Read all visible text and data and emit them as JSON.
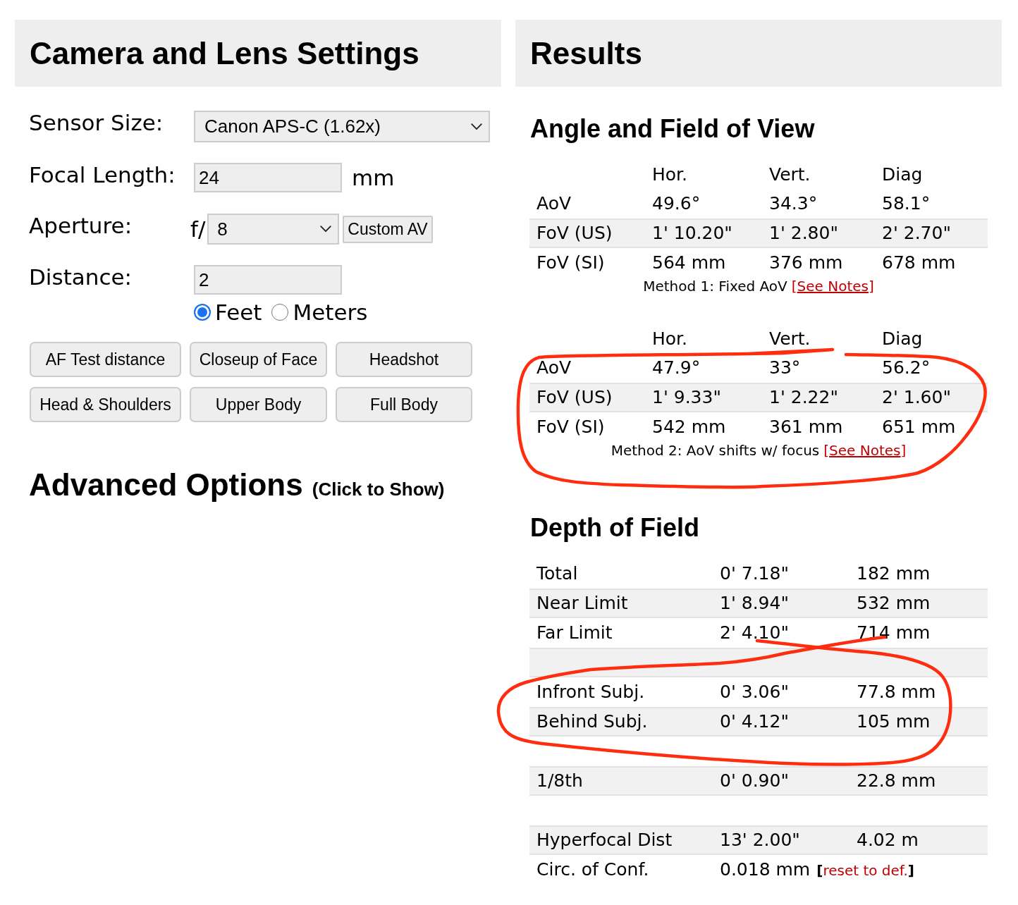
{
  "settings": {
    "title": "Camera and Lens Settings",
    "sensor_size": {
      "label": "Sensor Size:",
      "value": "Canon APS-C (1.62x)"
    },
    "focal_length": {
      "label": "Focal Length:",
      "value": "24",
      "unit": "mm"
    },
    "aperture": {
      "label": "Aperture:",
      "prefix": "f/",
      "value": "8",
      "button": "Custom AV"
    },
    "distance": {
      "label": "Distance:",
      "value": "2",
      "units": [
        {
          "label": "Feet",
          "selected": true
        },
        {
          "label": "Meters",
          "selected": false
        }
      ]
    },
    "presets": [
      "AF Test distance",
      "Closeup of Face",
      "Headshot",
      "Head & Shoulders",
      "Upper Body",
      "Full Body"
    ],
    "advanced": {
      "title": "Advanced Options",
      "hint": "(Click to Show)"
    }
  },
  "results": {
    "title": "Results",
    "angle_section": {
      "title": "Angle and Field of View",
      "tables": [
        {
          "columns": [
            "Hor.",
            "Vert.",
            "Diag"
          ],
          "rows": [
            {
              "label": "AoV",
              "values": [
                "49.6°",
                "34.3°",
                "58.1°"
              ]
            },
            {
              "label": "FoV (US)",
              "values": [
                "1' 10.20\"",
                "1' 2.80\"",
                "2' 2.70\""
              ]
            },
            {
              "label": "FoV (SI)",
              "values": [
                "564 mm",
                "376 mm",
                "678 mm"
              ]
            }
          ],
          "note": "Method 1: Fixed AoV",
          "link_open": "[",
          "link": "See Notes",
          "link_close": "]",
          "circled": false
        },
        {
          "columns": [
            "Hor.",
            "Vert.",
            "Diag"
          ],
          "rows": [
            {
              "label": "AoV",
              "values": [
                "47.9°",
                "33°",
                "56.2°"
              ]
            },
            {
              "label": "FoV (US)",
              "values": [
                "1' 9.33\"",
                "1' 2.22\"",
                "2' 1.60\""
              ]
            },
            {
              "label": "FoV (SI)",
              "values": [
                "542 mm",
                "361 mm",
                "651 mm"
              ]
            }
          ],
          "note": "Method 2: AoV shifts w/ focus",
          "link_open": "[",
          "link": "See Notes",
          "link_close": "]",
          "circled": true
        }
      ]
    },
    "dof_section": {
      "title": "Depth of Field",
      "rows": [
        {
          "kind": "data",
          "label": "Total",
          "imperial": "0' 7.18\"",
          "metric": "182 mm",
          "circled": false
        },
        {
          "kind": "data",
          "label": "Near Limit",
          "imperial": "1' 8.94\"",
          "metric": "532 mm",
          "circled": false
        },
        {
          "kind": "data",
          "label": "Far Limit",
          "imperial": "2' 4.10\"",
          "metric": "714 mm",
          "circled": false
        },
        {
          "kind": "spacer",
          "circled": false
        },
        {
          "kind": "data",
          "label": "Infront Subj.",
          "imperial": "0' 3.06\"",
          "metric": "77.8 mm",
          "circled": true
        },
        {
          "kind": "data",
          "label": "Behind Subj.",
          "imperial": "0' 4.12\"",
          "metric": "105 mm",
          "circled": true
        },
        {
          "kind": "spacer",
          "circled": false
        },
        {
          "kind": "data",
          "label": "1/8th",
          "imperial": "0' 0.90\"",
          "metric": "22.8 mm",
          "circled": false
        },
        {
          "kind": "spacer",
          "circled": false
        },
        {
          "kind": "data",
          "label": "Hyperfocal Dist",
          "imperial": "13' 2.00\"",
          "metric": "4.02 m",
          "circled": false
        },
        {
          "kind": "setting",
          "label": "Circ. of Conf.",
          "value": "0.018 mm",
          "link_open": "[",
          "link": "reset to def.",
          "link_close": "]",
          "circled": false
        }
      ]
    }
  }
}
